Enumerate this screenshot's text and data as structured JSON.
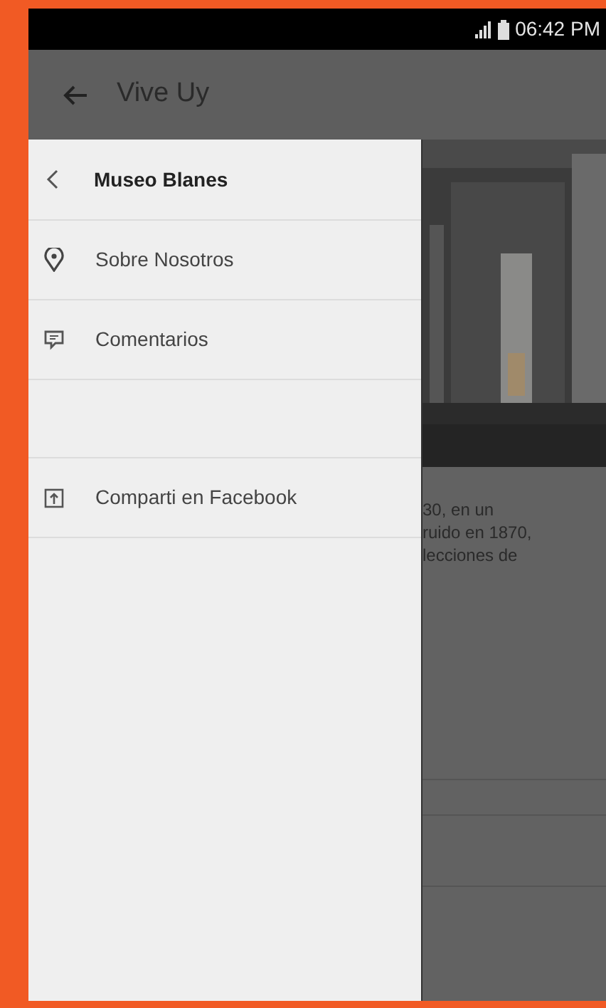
{
  "status_bar": {
    "time": "06:42 PM"
  },
  "app_bar": {
    "title": "Vive Uy"
  },
  "drawer": {
    "header": {
      "title": "Museo Blanes"
    },
    "items": [
      {
        "label": "Sobre Nosotros",
        "kind": "pin"
      },
      {
        "label": "Comentarios",
        "kind": "comment"
      }
    ],
    "share_items": [
      {
        "label": "Comparti en Facebook",
        "kind": "share"
      }
    ]
  },
  "background": {
    "text_lines": [
      "30, en un",
      "ruido en 1870,",
      "lecciones de"
    ]
  }
}
